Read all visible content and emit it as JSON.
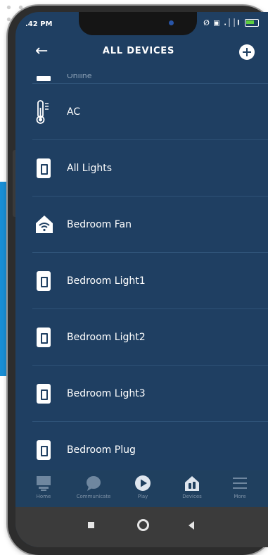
{
  "status_bar": {
    "time": ".42 PM",
    "indicators": "∅ ▣ .││l"
  },
  "header": {
    "title": "ALL DEVICES",
    "back_icon": "arrow-left-icon",
    "add_icon": "plus-circle-icon"
  },
  "devices": [
    {
      "label": "Online",
      "icon": "switch-icon"
    },
    {
      "label": "AC",
      "icon": "thermometer-icon"
    },
    {
      "label": "All Lights",
      "icon": "switch-icon"
    },
    {
      "label": "Bedroom Fan",
      "icon": "wifi-home-icon"
    },
    {
      "label": "Bedroom Light1",
      "icon": "switch-icon"
    },
    {
      "label": "Bedroom Light2",
      "icon": "switch-icon"
    },
    {
      "label": "Bedroom Light3",
      "icon": "switch-icon"
    },
    {
      "label": "Bedroom Plug",
      "icon": "switch-icon"
    }
  ],
  "bottom_nav": [
    {
      "label": "Home",
      "icon": "home-icon"
    },
    {
      "label": "Communicate",
      "icon": "chat-bubble-icon"
    },
    {
      "label": "Play",
      "icon": "play-icon"
    },
    {
      "label": "Devices",
      "icon": "devices-icon"
    },
    {
      "label": "More",
      "icon": "menu-icon"
    }
  ],
  "colors": {
    "screen_bg": "#1f3f62",
    "accent_blue": "#1a8fd6",
    "battery_green": "#5fcf3f"
  }
}
